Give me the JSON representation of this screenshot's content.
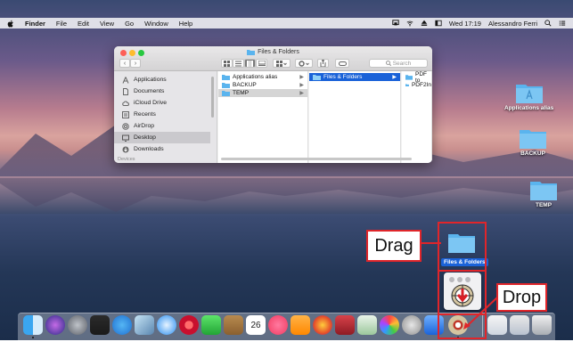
{
  "menubar": {
    "app_name": "Finder",
    "menus": [
      "File",
      "Edit",
      "View",
      "Go",
      "Window",
      "Help"
    ],
    "clock": "Wed 17:19",
    "user": "Alessandro Ferri"
  },
  "finder_window": {
    "title": "Files & Folders",
    "search_placeholder": "Search",
    "sidebar": {
      "items": [
        {
          "label": "Applications",
          "icon": "applications-icon"
        },
        {
          "label": "Documents",
          "icon": "documents-icon"
        },
        {
          "label": "iCloud Drive",
          "icon": "cloud-icon"
        },
        {
          "label": "Recents",
          "icon": "recents-icon"
        },
        {
          "label": "AirDrop",
          "icon": "airdrop-icon"
        },
        {
          "label": "Desktop",
          "icon": "desktop-icon",
          "selected": true
        },
        {
          "label": "Downloads",
          "icon": "downloads-icon"
        }
      ],
      "section_partial": "Devices"
    },
    "column1": [
      "Applications alias",
      "BACKUP",
      "TEMP"
    ],
    "column2": [
      "Files & Folders"
    ],
    "column3": [
      "PDF to",
      "PDF2In"
    ]
  },
  "desktop_icons": [
    {
      "label": "Applications alias"
    },
    {
      "label": "BACKUP"
    },
    {
      "label": "TEMP"
    }
  ],
  "annotation": {
    "drag_label": "Drag",
    "drop_label": "Drop",
    "dragged_item_label": "Files & Folders",
    "color": "#e0252a"
  },
  "dock": {
    "calendar_day": "26"
  },
  "colors": {
    "selection_blue": "#1a62d8",
    "folder_blue": "#5ab4ee"
  }
}
